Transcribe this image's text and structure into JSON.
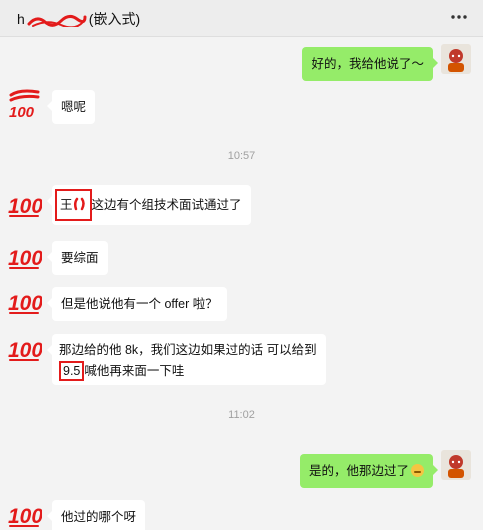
{
  "header": {
    "title_prefix": "h",
    "title_suffix": "(嵌入式)",
    "menu_icon": "more-horizontal-icon"
  },
  "messages": [
    {
      "side": "right",
      "text": "好的，我给他说了～"
    },
    {
      "side": "left",
      "text": "嗯呢"
    },
    {
      "type": "time",
      "text": "10:57"
    },
    {
      "side": "left",
      "highlight": "王",
      "text": "这边有个组技术面试通过了"
    },
    {
      "side": "left",
      "text": "要综面"
    },
    {
      "side": "left",
      "text": "但是他说他有一个 offer 啦？"
    },
    {
      "side": "left",
      "line1": "那边给的他 8k，我们这边如果过的话 可以给到",
      "highlight": "9.5",
      "line2": "喊他再来面一下哇"
    },
    {
      "type": "time",
      "text": "11:02"
    },
    {
      "side": "right",
      "text": "是的，他那边过了"
    },
    {
      "side": "left",
      "text": "他过的哪个呀"
    }
  ],
  "colors": {
    "background": "#f3f3f3",
    "bubble_right": "#95ec69",
    "bubble_left": "#ffffff",
    "highlight_box": "#e31b1b"
  }
}
